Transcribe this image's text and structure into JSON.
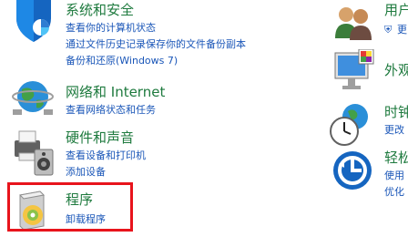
{
  "left_column": {
    "system_security": {
      "title": "系统和安全",
      "icon": "shield-icon",
      "links": [
        "查看你的计算机状态",
        "通过文件历史记录保存你的文件备份副本",
        "备份和还原(Windows 7)"
      ]
    },
    "network_internet": {
      "title": "网络和 Internet",
      "icon": "network-globe-icon",
      "links": [
        "查看网络状态和任务"
      ]
    },
    "hardware_sound": {
      "title": "硬件和声音",
      "icon": "printer-speaker-icon",
      "links": [
        "查看设备和打印机",
        "添加设备"
      ]
    },
    "programs": {
      "title": "程序",
      "icon": "programs-disc-icon",
      "links": [
        "卸载程序"
      ]
    }
  },
  "right_column": {
    "user_accounts": {
      "title": "用户",
      "icon": "users-icon",
      "links": [
        "更"
      ]
    },
    "appearance": {
      "title": "外观",
      "icon": "monitor-appearance-icon"
    },
    "clock_region": {
      "title": "时钟",
      "icon": "clock-globe-icon",
      "links": [
        "更改"
      ]
    },
    "ease_of_access": {
      "title": "轻松",
      "icon": "ease-of-access-icon",
      "links": [
        "使用",
        "优化"
      ]
    }
  },
  "colors": {
    "category_title": "#1e7a3e",
    "link": "#1a56b8",
    "highlight": "#e8141c"
  }
}
